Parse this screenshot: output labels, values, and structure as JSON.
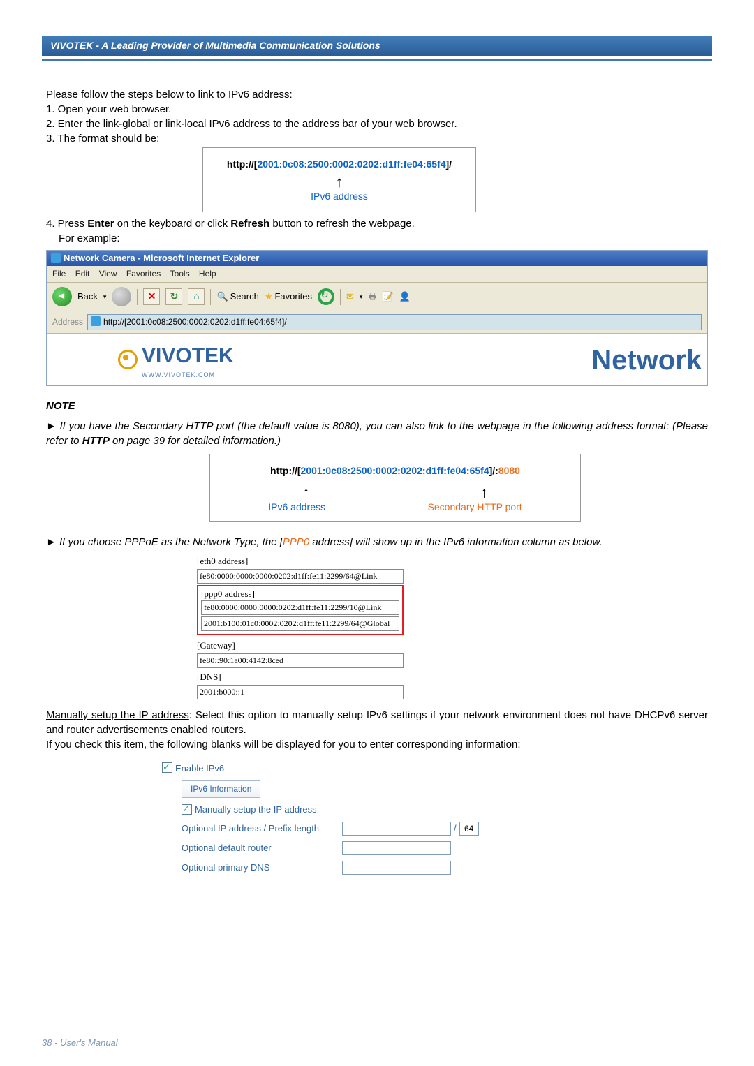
{
  "header": {
    "brand": "VIVOTEK - A Leading Provider of Multimedia Communication Solutions"
  },
  "steps": {
    "intro": "Please follow the steps below to link to IPv6 address:",
    "s1": "1. Open your web browser.",
    "s2": "2. Enter the link-global or link-local IPv6 address to the address bar of your web browser.",
    "s3": "3. The format should be:",
    "s4a": "4. Press ",
    "s4b": "Enter",
    "s4c": " on the keyboard or click ",
    "s4d": "Refresh",
    "s4e": " button to refresh the webpage.",
    "s4f": "For example:"
  },
  "url_example1": {
    "prefix": "http://[",
    "addr": "2001:0c08:2500:0002:0202:d1ff:fe04:65f4",
    "suffix": "]/",
    "caption": "IPv6 address"
  },
  "ie": {
    "title": "Network Camera - Microsoft Internet Explorer",
    "menu": [
      "File",
      "Edit",
      "View",
      "Favorites",
      "Tools",
      "Help"
    ],
    "toolbar": {
      "back": "Back",
      "search": "Search",
      "favorites": "Favorites"
    },
    "addr_label": "Address",
    "addr_value": "http://[2001:0c08:2500:0002:0202:d1ff:fe04:65f4]/",
    "logo_text": "VIVOTEK",
    "logo_sub": "WWW.VIVOTEK.COM",
    "right_title": "Network"
  },
  "note": {
    "heading": "NOTE",
    "item1_a": "► If you have the Secondary HTTP port (the default value is 8080), you can also link to the webpage in the following address format: (Please refer to ",
    "item1_b": "HTTP",
    "item1_c": " on page 39 for detailed information.)",
    "item2_a": "► If you choose PPPoE as the Network Type, the [",
    "item2_b": "PPP0",
    "item2_c": " address] will show up in the IPv6 information column as below."
  },
  "url_example2": {
    "prefix": "http://[",
    "addr": "2001:0c08:2500:0002:0202:d1ff:fe04:65f4",
    "mid": "]/:",
    "port": "8080",
    "caption1": "IPv6 address",
    "caption2": "Secondary HTTP port"
  },
  "ipv6info": {
    "eth0_title": "[eth0 address]",
    "eth0_val": "fe80:0000:0000:0000:0202:d1ff:fe11:2299/64@Link",
    "ppp0_title": "[ppp0 address]",
    "ppp0_val1": "fe80:0000:0000:0000:0202:d1ff:fe11:2299/10@Link",
    "ppp0_val2": "2001:b100:01c0:0002:0202:d1ff:fe11:2299/64@Global",
    "gw_title": "[Gateway]",
    "gw_val": "fe80::90:1a00:4142:8ced",
    "dns_title": "[DNS]",
    "dns_val": "2001:b000::1"
  },
  "manual": {
    "head": "Manually setup the IP address",
    "text1": ": Select this option to manually setup IPv6 settings if your network environment does not have DHCPv6 server and router advertisements enabled routers.",
    "text2": "If you check this item, the following blanks will be displayed for you to enter corresponding information:"
  },
  "form": {
    "enable": "Enable IPv6",
    "info_btn": "IPv6 Information",
    "manual_chk": "Manually setup the IP address",
    "row1": "Optional IP address / Prefix length",
    "row1_sep": "/",
    "row1_suffix": "64",
    "row2": "Optional default router",
    "row3": "Optional primary DNS"
  },
  "footer": {
    "text": "38 - User's Manual"
  }
}
